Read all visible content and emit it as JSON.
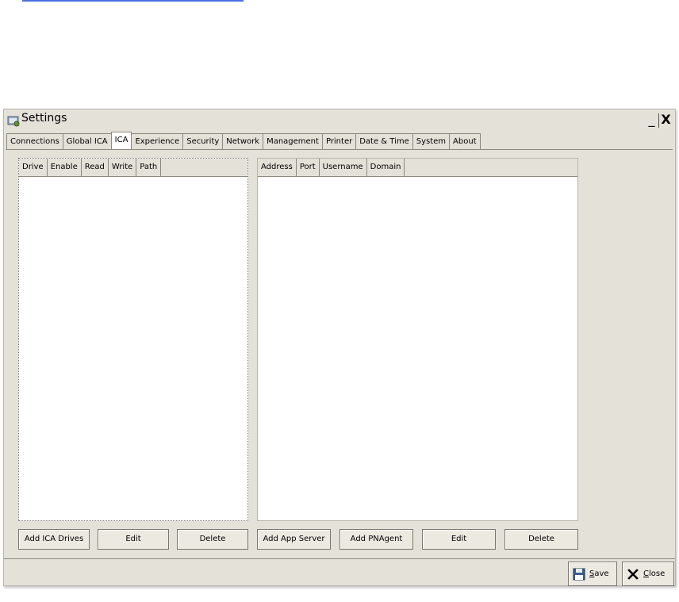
{
  "window": {
    "title": "Settings"
  },
  "window_controls": {
    "minimize": "_",
    "close": "X"
  },
  "tabs": [
    {
      "label": "Connections"
    },
    {
      "label": "Global ICA"
    },
    {
      "label": "ICA",
      "active": true
    },
    {
      "label": "Experience"
    },
    {
      "label": "Security"
    },
    {
      "label": "Network"
    },
    {
      "label": "Management"
    },
    {
      "label": "Printer"
    },
    {
      "label": "Date & Time"
    },
    {
      "label": "System"
    },
    {
      "label": "About"
    }
  ],
  "drives_list": {
    "columns": [
      "Drive",
      "Enable",
      "Read",
      "Write",
      "Path"
    ],
    "rows": [],
    "buttons": {
      "add": "Add ICA Drives",
      "edit": "Edit",
      "delete": "Delete"
    }
  },
  "servers_list": {
    "columns": [
      "Address",
      "Port",
      "Username",
      "Domain"
    ],
    "rows": [],
    "buttons": {
      "add_app_server": "Add App Server",
      "add_pnagent": "Add PNAgent",
      "edit": "Edit",
      "delete": "Delete"
    }
  },
  "footer": {
    "save": {
      "first": "S",
      "rest": "ave",
      "icon": "floppy-disk-icon"
    },
    "close": {
      "first": "C",
      "rest": "lose",
      "icon": "close-x-icon"
    }
  }
}
